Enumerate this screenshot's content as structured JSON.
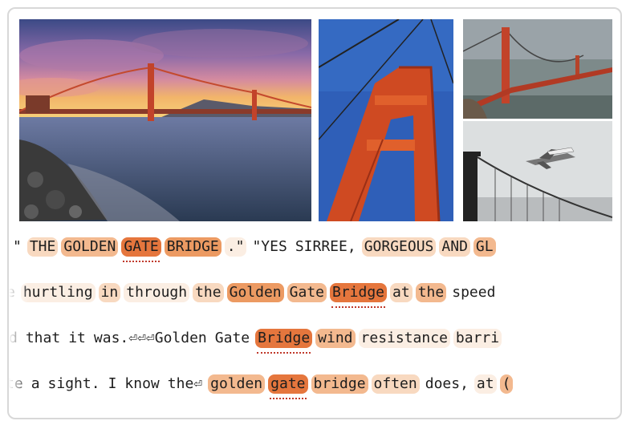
{
  "colors": {
    "heat_none": "transparent",
    "heat_1": "#fbeee3",
    "heat_2": "#f8d9c0",
    "heat_3": "#f3b98f",
    "heat_4": "#ec9a62",
    "heat_5": "#e5763d",
    "underline": "#c0392b"
  },
  "images": {
    "sunset": "sunset-golden-gate-photo",
    "tower": "tower-closeup-photo",
    "fog": "fog-bridge-photo",
    "plane": "shuttle-flyover-photo"
  },
  "lines": [
    {
      "tokens": [
        {
          "text": "\"",
          "heat": 0
        },
        {
          "text": "THE",
          "heat": 2
        },
        {
          "text": "GOLDEN",
          "heat": 3
        },
        {
          "text": "GATE",
          "heat": 5,
          "under": true
        },
        {
          "text": "BRIDGE",
          "heat": 4
        },
        {
          "text": ".\"",
          "heat": 1
        },
        {
          "text": "\"YES",
          "heat": 0
        },
        {
          "text": "SIRREE,",
          "heat": 0
        },
        {
          "text": "GORGEOUS",
          "heat": 2
        },
        {
          "text": "AND",
          "heat": 2
        },
        {
          "text": "GL",
          "heat": 3
        }
      ]
    },
    {
      "tokens": [
        {
          "text": "e",
          "heat": 0
        },
        {
          "text": "hurtling",
          "heat": 1
        },
        {
          "text": "in",
          "heat": 2
        },
        {
          "text": "through",
          "heat": 1
        },
        {
          "text": "the",
          "heat": 2
        },
        {
          "text": "Golden",
          "heat": 4
        },
        {
          "text": "Gate",
          "heat": 3
        },
        {
          "text": "Bridge",
          "heat": 5,
          "under": true
        },
        {
          "text": "at",
          "heat": 2
        },
        {
          "text": "the",
          "heat": 3
        },
        {
          "text": "speed",
          "heat": 0
        }
      ]
    },
    {
      "tokens": [
        {
          "text": "d",
          "heat": 0
        },
        {
          "text": "that",
          "heat": 0
        },
        {
          "text": "it",
          "heat": 0
        },
        {
          "text": "was.⏎⏎⏎Golden",
          "heat": 0
        },
        {
          "text": "Gate",
          "heat": 0
        },
        {
          "text": "Bridge",
          "heat": 5,
          "under": true
        },
        {
          "text": "wind",
          "heat": 3
        },
        {
          "text": "resistance",
          "heat": 1
        },
        {
          "text": "barri",
          "heat": 1
        }
      ]
    },
    {
      "tokens": [
        {
          "text": "te",
          "heat": 0
        },
        {
          "text": "a",
          "heat": 0
        },
        {
          "text": "sight.",
          "heat": 0
        },
        {
          "text": "I",
          "heat": 0
        },
        {
          "text": "know",
          "heat": 0
        },
        {
          "text": "the⏎",
          "heat": 0
        },
        {
          "text": "golden",
          "heat": 3
        },
        {
          "text": "gate",
          "heat": 5,
          "under": true
        },
        {
          "text": "bridge",
          "heat": 3
        },
        {
          "text": "often",
          "heat": 2
        },
        {
          "text": "does,",
          "heat": 0
        },
        {
          "text": "at",
          "heat": 1
        },
        {
          "text": "(",
          "heat": 3
        }
      ]
    }
  ]
}
